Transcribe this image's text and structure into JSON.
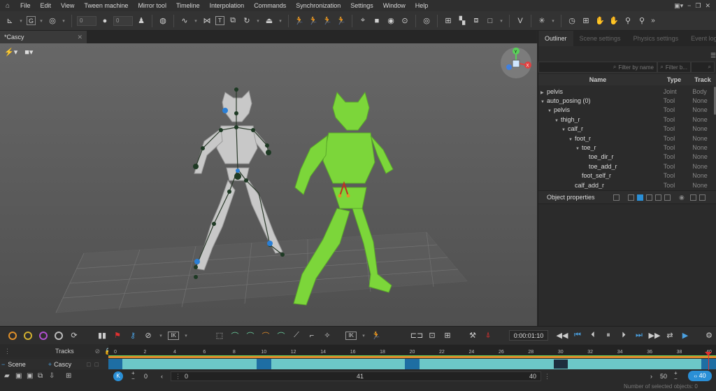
{
  "menu": [
    "File",
    "Edit",
    "View",
    "Tween machine",
    "Mirror tool",
    "Timeline",
    "Interpolation",
    "Commands",
    "Synchronization",
    "Settings",
    "Window",
    "Help"
  ],
  "toolbar": {
    "input_a": "0",
    "input_b": "0"
  },
  "document_tab": "*Cascy",
  "right_panel": {
    "tabs": [
      "Outliner",
      "Scene settings",
      "Physics settings",
      "Event log"
    ],
    "filter_name": "Filter by name",
    "filter_type": "Filter b...",
    "columns": {
      "name": "Name",
      "type": "Type",
      "track": "Track"
    },
    "rows": [
      {
        "name": "pelvis",
        "type": "Joint",
        "track": "Body",
        "depth": 0,
        "arrow": "right"
      },
      {
        "name": "auto_posing (0)",
        "type": "Tool",
        "track": "None",
        "depth": 0,
        "arrow": "down"
      },
      {
        "name": "pelvis",
        "type": "Tool",
        "track": "None",
        "depth": 1,
        "arrow": "down"
      },
      {
        "name": "thigh_r",
        "type": "Tool",
        "track": "None",
        "depth": 2,
        "arrow": "down"
      },
      {
        "name": "calf_r",
        "type": "Tool",
        "track": "None",
        "depth": 3,
        "arrow": "down"
      },
      {
        "name": "foot_r",
        "type": "Tool",
        "track": "None",
        "depth": 4,
        "arrow": "down"
      },
      {
        "name": "toe_r",
        "type": "Tool",
        "track": "None",
        "depth": 5,
        "arrow": "down"
      },
      {
        "name": "toe_dir_r",
        "type": "Tool",
        "track": "None",
        "depth": 6,
        "arrow": ""
      },
      {
        "name": "toe_add_r",
        "type": "Tool",
        "track": "None",
        "depth": 6,
        "arrow": ""
      },
      {
        "name": "foot_self_r",
        "type": "Tool",
        "track": "None",
        "depth": 5,
        "arrow": ""
      },
      {
        "name": "calf_add_r",
        "type": "Tool",
        "track": "None",
        "depth": 4,
        "arrow": ""
      }
    ],
    "object_properties": "Object properties"
  },
  "timeline": {
    "timecode": "0:00:01:10",
    "tracks_label": "Tracks",
    "scene_label": "Scene",
    "character_label": "Cascy",
    "ticks": [
      "0",
      "2",
      "4",
      "6",
      "8",
      "10",
      "12",
      "14",
      "16",
      "18",
      "20",
      "22",
      "24",
      "26",
      "28",
      "30",
      "32",
      "34",
      "36",
      "38",
      "40"
    ],
    "start_frame": "0",
    "range_start": "0",
    "current_frame": "41",
    "range_end": "40",
    "end_frame": "50",
    "playhead_frame": "40",
    "selected_objects": "Number of selected objects: 0"
  },
  "colors": {
    "accent_blue": "#2a8fd6",
    "rig_green": "#7cd63a",
    "track_cyan": "#6cc8c8",
    "track_dark": "#1e6ea3",
    "timeline_orange": "#e08a2a"
  }
}
